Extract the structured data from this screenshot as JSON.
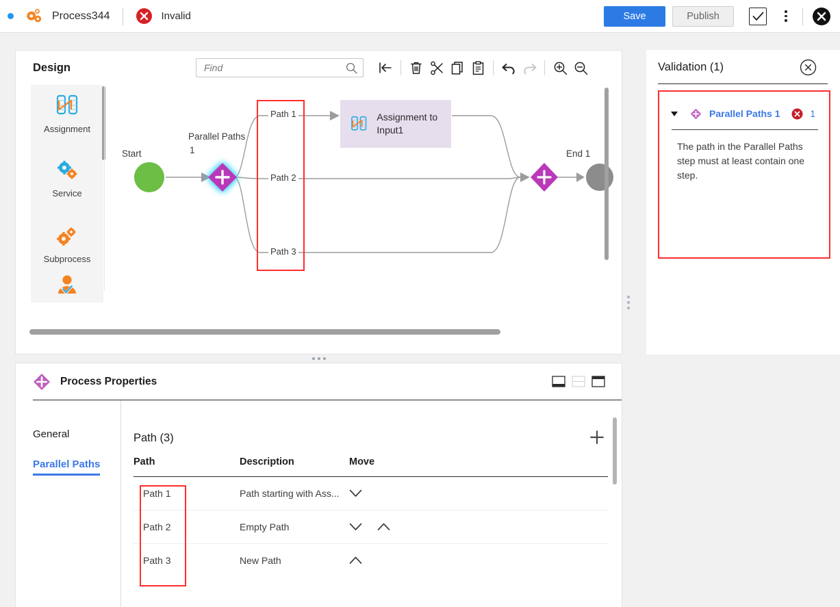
{
  "topbar": {
    "status_dot_color": "#2196f3",
    "process_icon": "gears-icon",
    "process_name": "Process344",
    "validity_icon": "error-circle-icon",
    "validity_label": "Invalid",
    "save_label": "Save",
    "publish_label": "Publish",
    "check_icon": "checkbox-check-icon",
    "menu_icon": "kebab-menu-icon",
    "close_icon": "close-circle-icon",
    "accent_color": "#2c7be5",
    "error_color": "#d62027"
  },
  "design": {
    "title": "Design",
    "find": {
      "placeholder": "Find",
      "value": ""
    },
    "toolbar": [
      {
        "name": "collapse-left-icon",
        "label": "Collapse",
        "disabled": false
      },
      {
        "name": "delete-icon",
        "label": "Delete",
        "disabled": false
      },
      {
        "name": "cut-icon",
        "label": "Cut",
        "disabled": false
      },
      {
        "name": "copy-icon",
        "label": "Copy",
        "disabled": false
      },
      {
        "name": "paste-icon",
        "label": "Paste",
        "disabled": false
      },
      {
        "name": "undo-icon",
        "label": "Undo",
        "disabled": false
      },
      {
        "name": "redo-icon",
        "label": "Redo",
        "disabled": true
      },
      {
        "name": "zoom-in-icon",
        "label": "Zoom In",
        "disabled": false
      },
      {
        "name": "zoom-out-icon",
        "label": "Zoom Out",
        "disabled": false
      }
    ],
    "palette": [
      {
        "label": "Assignment",
        "icon": "assignment-icon"
      },
      {
        "label": "Service",
        "icon": "service-gears-icon"
      },
      {
        "label": "Subprocess",
        "icon": "subprocess-gears-icon"
      },
      {
        "label": "",
        "icon": "person-approval-icon"
      }
    ],
    "diagram": {
      "start_label": "Start",
      "start_color": "#6cbe45",
      "gateway_label": "Parallel Paths",
      "gateway_label_2": "1",
      "gateway_color": "#b939b9",
      "gateway_selected": true,
      "paths": [
        "Path 1",
        "Path 2",
        "Path 3"
      ],
      "assignment_step_label": "Assignment to Input1",
      "assignment_step_color": "#e6dded",
      "join_color": "#b939b9",
      "end_label": "End 1",
      "end_color": "#8c8c8c",
      "highlight_color": "#ff2d2d"
    }
  },
  "validation": {
    "title": "Validation (1)",
    "close_icon": "close-circle-outline-icon",
    "item": {
      "caret": "caret-down-icon",
      "step_icon": "parallel-paths-diamond-icon",
      "step_name": "Parallel Paths 1",
      "error_icon": "error-badge-icon",
      "error_count": "1",
      "message": "The path in the Parallel Paths step must at least contain one step."
    }
  },
  "properties": {
    "icon": "parallel-paths-diamond-icon",
    "title": "Process Properties",
    "layout_buttons": [
      {
        "name": "layout-bottom-panel-icon",
        "active": true
      },
      {
        "name": "layout-split-panel-icon",
        "active": false
      },
      {
        "name": "layout-top-panel-icon",
        "active": true
      }
    ],
    "tabs": [
      {
        "label": "General",
        "active": false
      },
      {
        "label": "Parallel Paths",
        "active": true
      }
    ],
    "section_heading": "Path (3)",
    "add_icon": "add-plus-icon",
    "table": {
      "columns": [
        "Path",
        "Description",
        "Move"
      ],
      "rows": [
        {
          "path": "Path 1",
          "description": "Path starting with Ass...",
          "move": [
            "down"
          ]
        },
        {
          "path": "Path 2",
          "description": "Empty Path",
          "move": [
            "down",
            "up"
          ]
        },
        {
          "path": "Path 3",
          "description": "New Path",
          "move": [
            "up"
          ]
        }
      ]
    }
  }
}
